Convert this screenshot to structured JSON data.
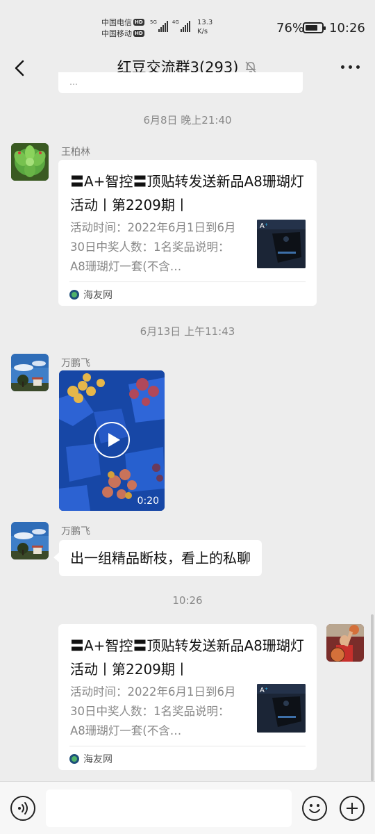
{
  "status_bar": {
    "carrier1": "中国电信",
    "carrier2": "中国移动",
    "hd": "HD",
    "net1": "5G",
    "net2": "4G",
    "speed_value": "13.3",
    "speed_unit": "K/s",
    "battery_pct": "76%",
    "battery_level": 0.76,
    "time": "10:26"
  },
  "header": {
    "title": "红豆交流群3(293)",
    "icons": {
      "back": "back-arrow-icon",
      "mute": "bell-muted-icon",
      "more": "more-dots-icon"
    }
  },
  "messages": {
    "ts1": "6月8日 晚上21:40",
    "ts2": "6月13日 上午11:43",
    "ts3": "10:26",
    "msg1": {
      "sender": "王柏林",
      "title": "〓A+智控〓顶贴转发送新品A8珊瑚灯活动丨第2209期丨",
      "desc": "活动时间：2022年6月1日到6月30日中奖人数：1名奖品说明：A8珊瑚灯一套(不含…",
      "source": "海友网"
    },
    "msg2": {
      "sender": "万鹏飞",
      "video_duration": "0:20"
    },
    "msg3": {
      "sender": "万鹏飞",
      "text": "出一组精品断枝，看上的私聊"
    },
    "msg4": {
      "title": "〓A+智控〓顶贴转发送新品A8珊瑚灯活动丨第2209期丨",
      "desc": "活动时间：2022年6月1日到6月30日中奖人数：1名奖品说明：A8珊瑚灯一套(不含…",
      "source": "海友网"
    }
  },
  "input_bar": {
    "placeholder": "",
    "icons": {
      "voice": "voice-icon",
      "emoji": "emoji-icon",
      "plus": "plus-icon"
    }
  }
}
